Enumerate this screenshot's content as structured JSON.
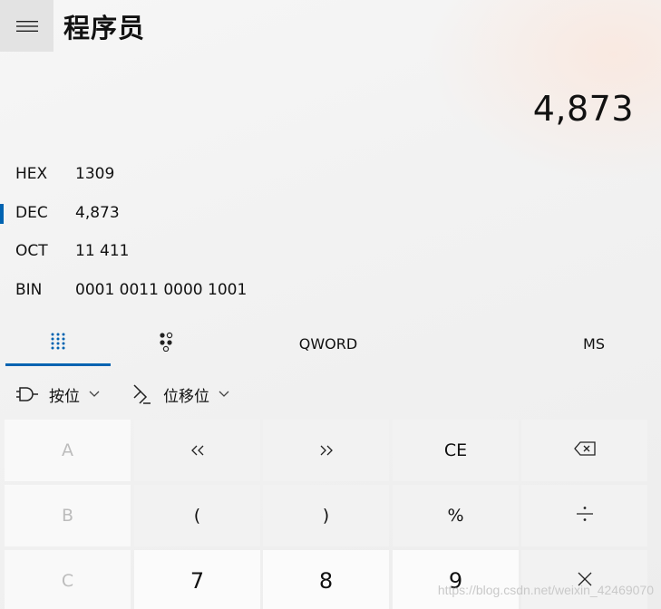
{
  "header": {
    "menu_icon": "hamburger-icon",
    "title": "程序员"
  },
  "display": {
    "value": "4,873"
  },
  "radix": [
    {
      "name": "HEX",
      "value": "1309",
      "selected": false
    },
    {
      "name": "DEC",
      "value": "4,873",
      "selected": true
    },
    {
      "name": "OCT",
      "value": "11 411",
      "selected": false
    },
    {
      "name": "BIN",
      "value": "0001 0011 0000 1001",
      "selected": false
    }
  ],
  "tabs": {
    "keypad_icon": "full-keypad-icon",
    "bit_icon": "bit-toggle-keypad-icon",
    "word_size": "QWORD",
    "memory": "MS"
  },
  "ops": {
    "bitwise_label": "按位",
    "bitwise_icon": "logic-gate-icon",
    "bitshift_label": "位移位",
    "bitshift_icon": "bit-shift-icon"
  },
  "keys": {
    "row1": [
      "A",
      "<<",
      ">>",
      "CE",
      "backspace-icon"
    ],
    "row2": [
      "B",
      "(",
      ")",
      "%",
      "divide-icon"
    ],
    "row3": [
      "C",
      "7",
      "8",
      "9",
      "multiply-icon"
    ]
  },
  "watermark": "https://blog.csdn.net/weixin_42469070"
}
